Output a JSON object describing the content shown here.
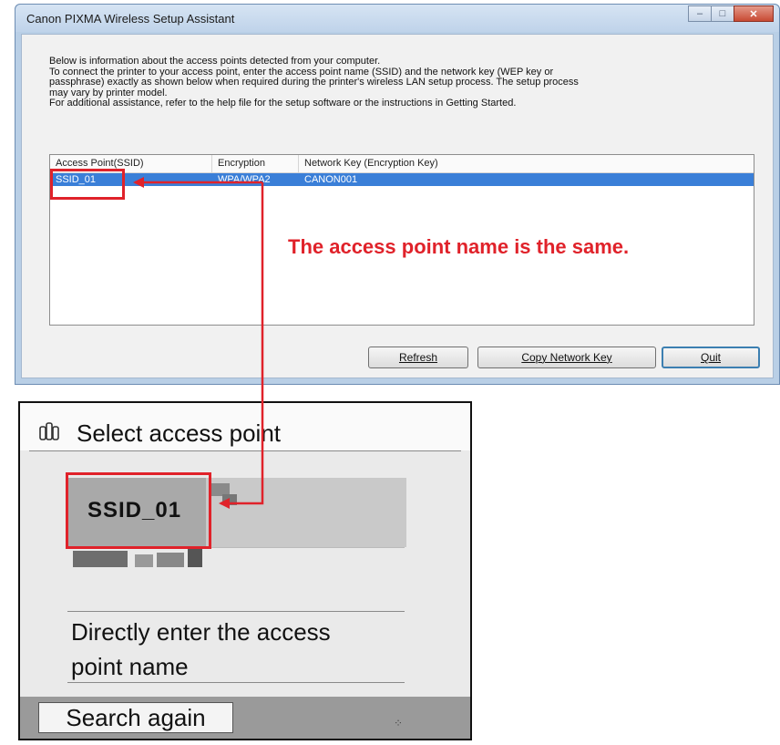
{
  "dialog": {
    "title": "Canon PIXMA Wireless Setup Assistant",
    "window_controls": {
      "minimize": "–",
      "maximize": "□",
      "close": "✕"
    },
    "info_lines": [
      "Below is information about the access points detected from your computer.",
      "To connect the printer to your access point, enter the access point name (SSID) and the network key (WEP key or",
      "passphrase) exactly as shown below when required during the printer's wireless LAN setup process. The setup process",
      "may vary by printer model.",
      "For additional assistance, refer to the help file for the setup software or the instructions in Getting Started."
    ],
    "list": {
      "columns": [
        "Access Point(SSID)",
        "Encryption",
        "Network Key (Encryption Key)"
      ],
      "rows": [
        {
          "ssid": "SSID_01",
          "encryption": "WPA/WPA2",
          "key": "CANON001"
        }
      ]
    },
    "buttons": {
      "refresh": {
        "label": "Refresh"
      },
      "copy": {
        "label": "Copy Network Key"
      },
      "quit": {
        "label": "Quit"
      }
    }
  },
  "annotation": {
    "text": "The access point name is the same.",
    "color": "#e0222a"
  },
  "lcd": {
    "title": "Select access point",
    "icon": "wireless-icon",
    "selected_item": "SSID_01",
    "option": "Directly enter the access point name",
    "option_lines": [
      "Directly enter the access",
      "point name"
    ],
    "search_button": "Search again"
  },
  "colors": {
    "selection": "#3a7fd8",
    "highlight": "#e0222a",
    "title_bar": "#bfd3ea"
  }
}
